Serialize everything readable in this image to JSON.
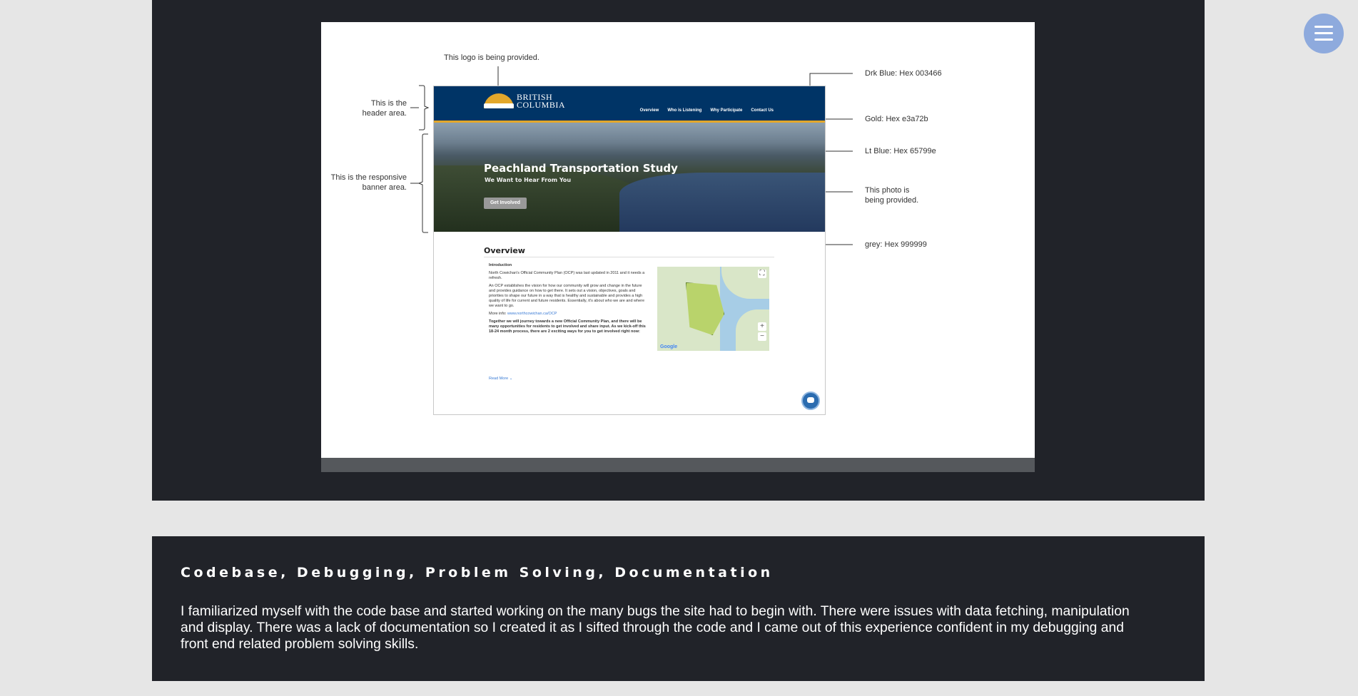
{
  "slide": {
    "annotations": {
      "logo_note": "This logo is being provided.",
      "header_note": "This is the\nheader area.",
      "banner_note": "This is the responsive\nbanner area.",
      "drk_blue": "Drk Blue: Hex 003466",
      "gold": "Gold: Hex e3a72b",
      "lt_blue": "Lt Blue: Hex 65799e",
      "photo_note": "This photo is\nbeing provided.",
      "grey": "grey: Hex 999999"
    },
    "mockup": {
      "logo_line1": "BRITISH",
      "logo_line2": "COLUMBIA",
      "nav": [
        "Overview",
        "Who is Listening",
        "Why Participate",
        "Contact Us"
      ],
      "banner_title": "Peachland Transportation Study",
      "banner_subtitle": "We Want to Hear From You",
      "banner_button": "Get Involved",
      "overview_title": "Overview",
      "intro_heading": "Introduction",
      "intro_p1": "North Cowichan's Official Community Plan (OCP) was last updated in 2011 and it needs a refresh.",
      "intro_p2": "An OCP establishes the vision for how our community will grow and change in the future and provides guidance on how to get there. It sets out a vision, objectives, goals and priorities to shape our future in a way that is healthy and sustainable and provides a high quality of life for current and future residents. Essentially, it's about who we are and where we want to go.",
      "more_info_label": "More info:",
      "more_info_link": "www.northcowichan.ca/OCP",
      "intro_bold": "Together we will journey towards a new Official Community Plan, and there will be many opportunities for residents to get involved and share input. As we kick-off this 18-24 month process, there are 2 exciting ways for you to get involved right now:",
      "read_more": "Read More",
      "map_google": "Google"
    },
    "colors": {
      "drk_blue": "#003466",
      "gold": "#e3a72b",
      "lt_blue": "#65799e",
      "grey": "#999999"
    }
  },
  "menu": {
    "icon": "hamburger-menu-icon"
  },
  "section": {
    "title": "Codebase, Debugging, Problem Solving, Documentation",
    "body": "I familiarized myself with the code base and started working on the many bugs the site had to begin with. There were issues with data fetching, manipulation and display. There was a lack of documentation so I created it as I sifted through the code and I came out of this experience confident in my debugging and front end related problem solving skills."
  }
}
